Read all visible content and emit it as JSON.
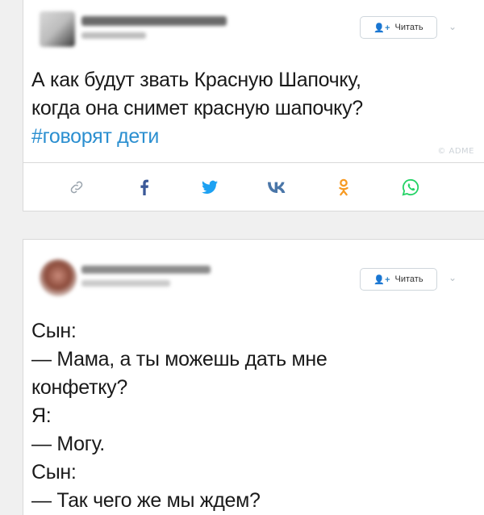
{
  "colors": {
    "link": "#2b8fd0",
    "text": "#1a1a1a",
    "facebook": "#3b5998",
    "twitter": "#1da1f2",
    "vk": "#4a76a8",
    "odnoklassniki": "#f79a22",
    "whatsapp": "#25d366"
  },
  "tweet1": {
    "follow_label": "Читать",
    "text_lines": [
      "А как будут звать Красную Шапочку,",
      "когда она снимет красную шапочку?"
    ],
    "hashtag": "#говорят дети",
    "watermark": "© ADME"
  },
  "share_bar": {
    "icons": [
      "link-icon",
      "facebook-icon",
      "twitter-icon",
      "vk-icon",
      "odnoklassniki-icon",
      "whatsapp-icon"
    ]
  },
  "tweet2": {
    "follow_label": "Читать",
    "text_lines": [
      "Сын:",
      "— Мама, а ты можешь дать мне",
      "конфетку?",
      "Я:",
      "— Могу.",
      "Сын:",
      "— Так чего же мы ждем?"
    ]
  }
}
